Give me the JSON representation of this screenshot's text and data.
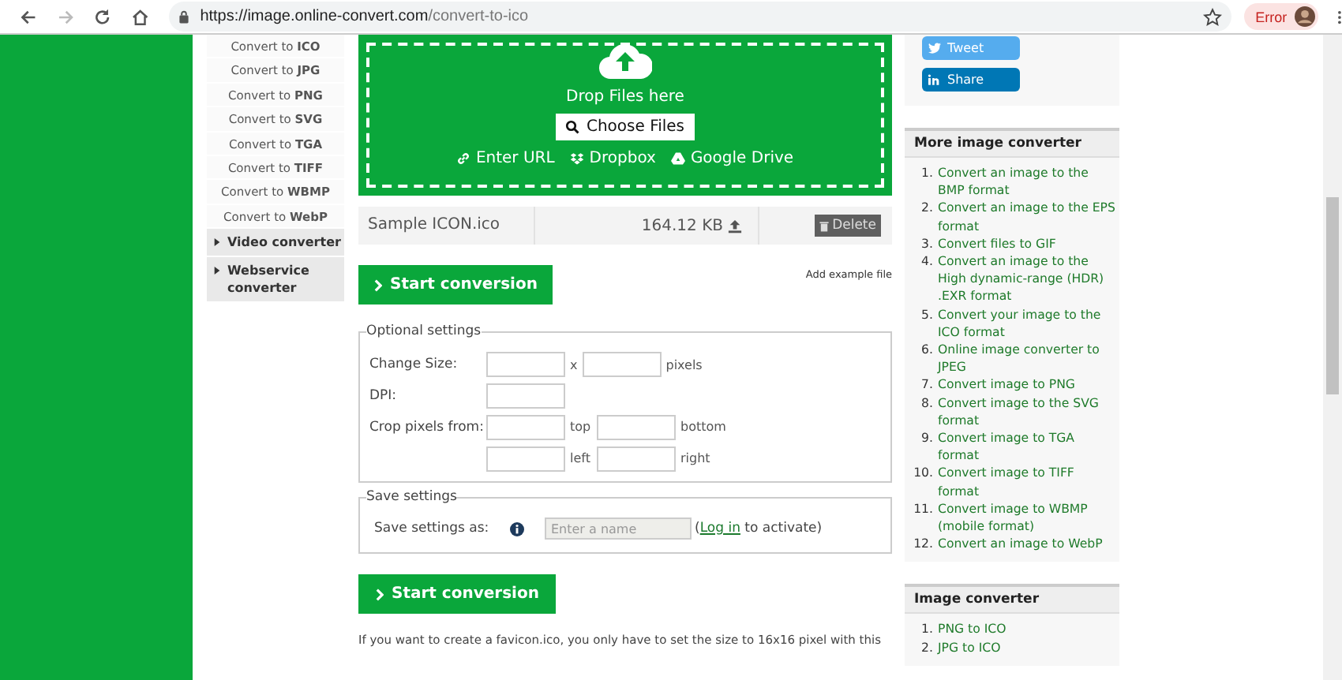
{
  "browser": {
    "url_host": "https://image.online-convert.com",
    "url_path": "/convert-to-ico",
    "back_disabled": false,
    "forward_disabled": true,
    "profile_label": "Error"
  },
  "sidebar": {
    "items": [
      {
        "kind": "link",
        "label": "Convert to **ICO**"
      },
      {
        "kind": "link",
        "label": "Convert to **JPG**"
      },
      {
        "kind": "link",
        "label": "Convert to **PNG**"
      },
      {
        "kind": "link",
        "label": "Convert to **SVG**"
      },
      {
        "kind": "link",
        "label": "Convert to **TGA**"
      },
      {
        "kind": "link",
        "label": "Convert to **TIFF**"
      },
      {
        "kind": "link",
        "label": "Convert to **WBMP**"
      },
      {
        "kind": "link",
        "label": "Convert to **WebP**"
      },
      {
        "kind": "group",
        "label": "Video converter",
        "expanded": false
      },
      {
        "kind": "group",
        "label": "Webservice converter",
        "expanded": false
      }
    ]
  },
  "upload": {
    "drop_text": "Drop Files here",
    "choose_button": "Choose Files",
    "sources": [
      {
        "kind": "url",
        "label": "Enter URL"
      },
      {
        "kind": "dropbox",
        "label": "Dropbox"
      },
      {
        "kind": "drive",
        "label": "Google Drive"
      }
    ]
  },
  "file": {
    "name": "Sample ICON.ico",
    "size": "164.12 KB",
    "delete_button": "Delete"
  },
  "start_button": "Start conversion",
  "add_example": "Add example file",
  "optional_settings": {
    "legend": "Optional settings",
    "change_size_label": "Change Size:",
    "size_separator": "x",
    "size_unit": "pixels",
    "dpi_label": "DPI:",
    "crop_label": "Crop pixels from:",
    "crop_sides": [
      "top",
      "bottom",
      "left",
      "right"
    ]
  },
  "save_settings": {
    "legend": "Save settings",
    "label": "Save settings as:",
    "placeholder": "Enter a name",
    "login_link": "Log in",
    "suffix_open": "(",
    "suffix_rest": " to activate)"
  },
  "start_button_2": "Start conversion",
  "footer_text": "If you want to create a favicon.ico, you only have to set the size to 16x16 pixel with this",
  "share": [
    {
      "kind": "twitter",
      "label": "Tweet"
    },
    {
      "kind": "linkedin",
      "label": "Share"
    }
  ],
  "panels": [
    {
      "title": "More image converter",
      "items": [
        {
          "number": "1.",
          "text": "Convert an image to the BMP format"
        },
        {
          "number": "2.",
          "text": "Convert an image to the EPS format"
        },
        {
          "number": "3.",
          "text": "Convert files to GIF"
        },
        {
          "number": "4.",
          "text": "Convert an image to the High dynamic-range (HDR) .EXR format"
        },
        {
          "number": "5.",
          "text": "Convert your image to the ICO format"
        },
        {
          "number": "6.",
          "text": "Online image converter to JPEG"
        },
        {
          "number": "7.",
          "text": "Convert image to PNG"
        },
        {
          "number": "8.",
          "text": "Convert image to the SVG format"
        },
        {
          "number": "9.",
          "text": "Convert image to TGA format"
        },
        {
          "number": "10.",
          "text": "Convert image to TIFF format"
        },
        {
          "number": "11.",
          "text": "Convert image to WBMP (mobile format)"
        },
        {
          "number": "12.",
          "text": "Convert an image to WebP"
        }
      ]
    },
    {
      "title": "Image converter",
      "items": [
        {
          "number": "1.",
          "text": "PNG to ICO"
        },
        {
          "number": "2.",
          "text": "JPG to ICO"
        }
      ]
    }
  ]
}
